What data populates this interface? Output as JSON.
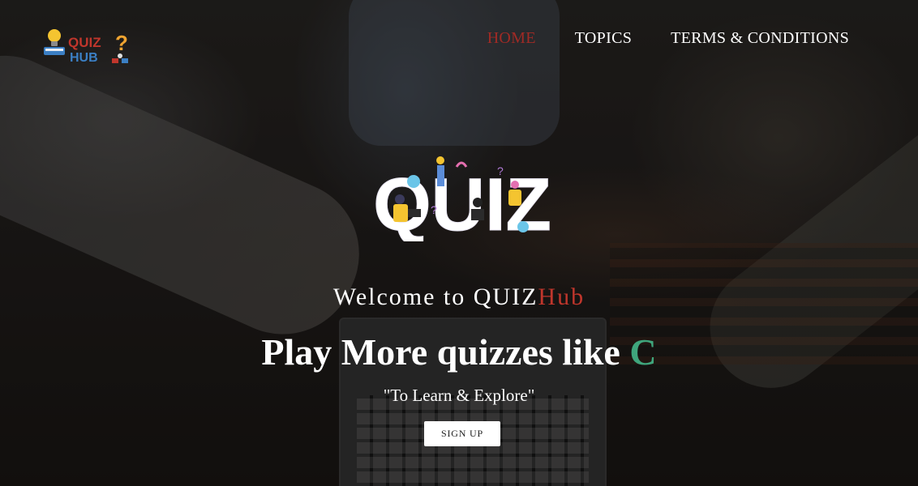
{
  "brand": {
    "logo_text_line1": "QUIZ",
    "logo_text_line2": "HUB",
    "icon": "lightbulb-book-question-icon",
    "accent": "#a02a25"
  },
  "nav": {
    "items": [
      {
        "label": "HOME",
        "active": true
      },
      {
        "label": "TOPICS",
        "active": false
      },
      {
        "label": "TERMS & CONDITIONS",
        "active": false
      }
    ]
  },
  "hero": {
    "art_word": "QUIZ",
    "welcome_prefix": "Welcome to QUIZ",
    "welcome_suffix": "Hub",
    "headline_prefix": "Play More quizzes like ",
    "headline_highlight": "C",
    "tagline": "\"To Learn & Explore\"",
    "signup_label": "SIGN UP"
  },
  "colors": {
    "active_nav": "#a02a25",
    "hub_red": "#c0362c",
    "highlight_green": "#3fa57c",
    "button_bg": "#ffffff"
  }
}
